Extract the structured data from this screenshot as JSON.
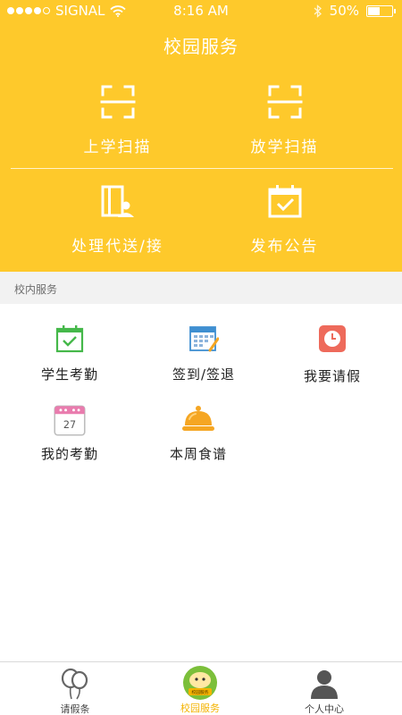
{
  "status_bar": {
    "carrier": "SIGNAL",
    "time": "8:16 AM",
    "battery": "50%",
    "battery_fraction": 0.5
  },
  "header": {
    "title": "校园服务"
  },
  "quick_actions": [
    {
      "label": "上学扫描",
      "icon": "scan-frame-icon"
    },
    {
      "label": "放学扫描",
      "icon": "scan-frame-icon"
    },
    {
      "label": "处理代送/接",
      "icon": "book-person-icon"
    },
    {
      "label": "发布公告",
      "icon": "calendar-check-icon"
    }
  ],
  "section": {
    "title": "校内服务"
  },
  "services": [
    {
      "label": "学生考勤",
      "icon": "calendar-check-icon"
    },
    {
      "label": "签到/签退",
      "icon": "calendar-grid-pen-icon"
    },
    {
      "label": "我要请假",
      "icon": "clock-icon"
    },
    {
      "label": "我的考勤",
      "icon": "date-calendar-icon",
      "icon_text": "27"
    },
    {
      "label": "本周食谱",
      "icon": "food-cloche-icon"
    }
  ],
  "tabs": [
    {
      "label": "请假条",
      "icon": "balloons-icon",
      "active": false
    },
    {
      "label": "校园服务",
      "icon": "campus-badge-icon",
      "badge_text": "校园服务",
      "active": true
    },
    {
      "label": "个人中心",
      "icon": "person-icon",
      "active": false
    }
  ],
  "colors": {
    "brand_yellow": "#fec92b",
    "section_bg": "#f2f2f2",
    "icon_green": "#45b84a",
    "icon_blue": "#3f8fd1",
    "icon_red": "#ee6a5b",
    "icon_pink": "#e97cae",
    "icon_orange": "#f5a623"
  }
}
